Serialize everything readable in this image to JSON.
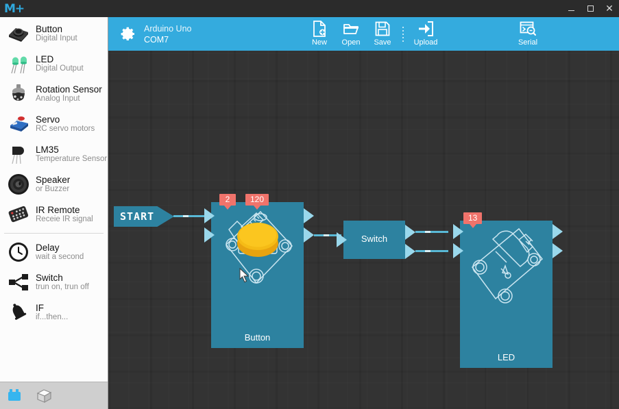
{
  "window": {
    "logo": "M+",
    "controls": [
      {
        "name": "minimize-button",
        "label": "–"
      },
      {
        "name": "maximize-button",
        "label": "□"
      },
      {
        "name": "close-button",
        "label": "✕"
      }
    ]
  },
  "header": {
    "device_name": "Arduino Uno",
    "device_port": "COM7",
    "tools": [
      {
        "label": "New",
        "icon": "new-file-icon"
      },
      {
        "label": "Open",
        "icon": "open-folder-icon"
      },
      {
        "label": "Save",
        "icon": "save-disk-icon"
      },
      {
        "label": "Upload",
        "icon": "upload-arrow-icon"
      },
      {
        "label": "Serial",
        "icon": "serial-monitor-icon"
      }
    ]
  },
  "sidebar": {
    "groups": [
      {
        "items": [
          {
            "title": "Button",
            "subtitle": "Digital Input",
            "icon": "push-button-icon"
          },
          {
            "title": "LED",
            "subtitle": "Digital Output",
            "icon": "led-icon"
          },
          {
            "title": "Rotation Sensor",
            "subtitle": "Analog Input",
            "icon": "potentiometer-icon"
          },
          {
            "title": "Servo",
            "subtitle": "RC servo motors",
            "icon": "servo-motor-icon"
          },
          {
            "title": "LM35",
            "subtitle": "Temperature Sensor",
            "icon": "lm35-sensor-icon"
          },
          {
            "title": "Speaker",
            "subtitle": "or Buzzer",
            "icon": "speaker-icon"
          },
          {
            "title": "IR Remote",
            "subtitle": "Receie IR signal",
            "icon": "ir-remote-icon"
          }
        ]
      },
      {
        "items": [
          {
            "title": "Delay",
            "subtitle": "wait a second",
            "icon": "clock-icon"
          },
          {
            "title": "Switch",
            "subtitle": "trun on, trun off",
            "icon": "branch-icon"
          },
          {
            "title": "IF",
            "subtitle": "if...then...",
            "icon": "bell-icon"
          }
        ]
      }
    ],
    "footer": [
      {
        "name": "blocks-view-icon",
        "label": "blocks"
      },
      {
        "name": "package-view-icon",
        "label": "package"
      }
    ]
  },
  "canvas": {
    "start": {
      "label": "START"
    },
    "nodes": [
      {
        "id": "button",
        "label": "Button",
        "badges": [
          "2",
          "120"
        ]
      },
      {
        "id": "switch",
        "label": "Switch",
        "badges": []
      },
      {
        "id": "led",
        "label": "LED",
        "badges": [
          "13"
        ]
      }
    ]
  },
  "colors": {
    "accent": "#34abde",
    "node": "#2d82a0",
    "badge": "#f0736b",
    "canvas": "#333333",
    "port": "#9ad8ec"
  }
}
